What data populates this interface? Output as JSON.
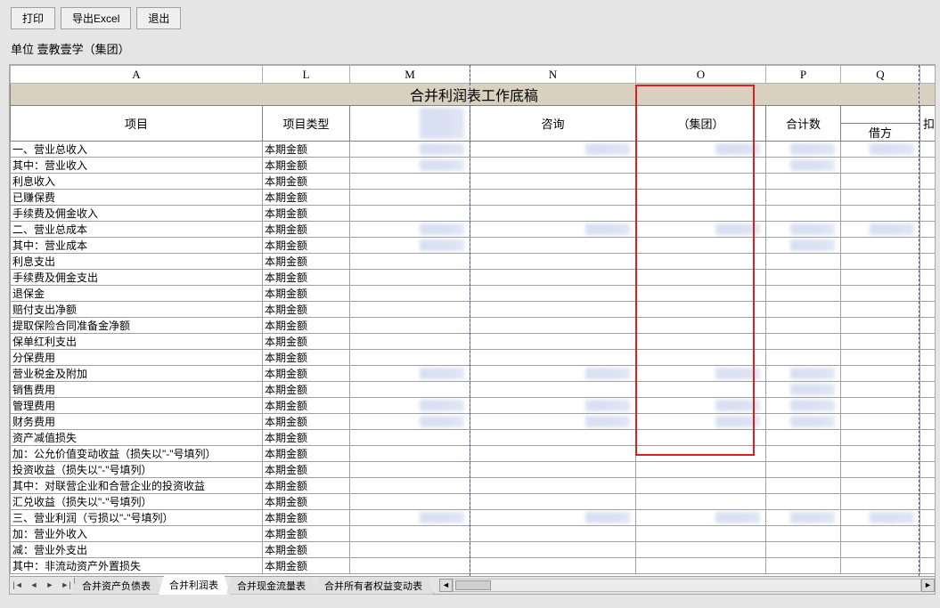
{
  "toolbar": {
    "print": "打印",
    "export": "导出Excel",
    "exit": "退出"
  },
  "unit_label": "单位  壹教壹学（集团）",
  "columns": [
    "A",
    "L",
    "M",
    "N",
    "O",
    "P",
    "Q",
    ""
  ],
  "title": "合并利润表工作底稿",
  "headers": {
    "project": "项目",
    "project_type": "项目类型",
    "col_m": "",
    "col_n": "咨询",
    "col_o": "（集团）",
    "col_p": "合计数",
    "col_q": "借方",
    "col_r": "扣"
  },
  "rows": [
    {
      "a": "一、营业总收入",
      "l": "本期金额",
      "blur": [
        "m",
        "n",
        "o",
        "p",
        "q"
      ]
    },
    {
      "a": "其中：营业收入",
      "l": "本期金额",
      "blur": [
        "m",
        "p"
      ]
    },
    {
      "a": "利息收入",
      "l": "本期金额"
    },
    {
      "a": "已赚保费",
      "l": "本期金额"
    },
    {
      "a": "手续费及佣金收入",
      "l": "本期金额"
    },
    {
      "a": "二、营业总成本",
      "l": "本期金额",
      "blur": [
        "m",
        "n",
        "o",
        "p",
        "q"
      ]
    },
    {
      "a": "其中：营业成本",
      "l": "本期金额",
      "blur": [
        "m",
        "p"
      ]
    },
    {
      "a": "利息支出",
      "l": "本期金额"
    },
    {
      "a": "手续费及佣金支出",
      "l": "本期金额"
    },
    {
      "a": "退保金",
      "l": "本期金额"
    },
    {
      "a": "赔付支出净额",
      "l": "本期金额"
    },
    {
      "a": "提取保险合同准备金净额",
      "l": "本期金额"
    },
    {
      "a": "保单红利支出",
      "l": "本期金额"
    },
    {
      "a": "分保费用",
      "l": "本期金额"
    },
    {
      "a": "营业税金及附加",
      "l": "本期金额",
      "blur": [
        "m",
        "n",
        "o",
        "p"
      ]
    },
    {
      "a": "销售费用",
      "l": "本期金额",
      "blur": [
        "p"
      ]
    },
    {
      "a": "管理费用",
      "l": "本期金额",
      "blur": [
        "m",
        "n",
        "o",
        "p"
      ]
    },
    {
      "a": "财务费用",
      "l": "本期金额",
      "blur": [
        "m",
        "n",
        "o",
        "p"
      ]
    },
    {
      "a": "资产减值损失",
      "l": "本期金额"
    },
    {
      "a": "加：公允价值变动收益（损失以\"-\"号填列）",
      "l": "本期金额"
    },
    {
      "a": "投资收益（损失以\"-\"号填列）",
      "l": "本期金额"
    },
    {
      "a": "其中：对联营企业和合营企业的投资收益",
      "l": "本期金额"
    },
    {
      "a": "汇兑收益（损失以\"-\"号填列）",
      "l": "本期金额"
    },
    {
      "a": "三、营业利润（亏损以\"-\"号填列）",
      "l": "本期金额",
      "blur": [
        "m",
        "n",
        "o",
        "p",
        "q"
      ]
    },
    {
      "a": "加：营业外收入",
      "l": "本期金额"
    },
    {
      "a": "减：营业外支出",
      "l": "本期金额"
    },
    {
      "a": "其中：非流动资产外置损失",
      "l": "本期金额"
    }
  ],
  "tabs": {
    "t1": "合并资产负债表",
    "t2": "合并利润表",
    "t3": "合并现金流量表",
    "t4": "合并所有者权益变动表"
  }
}
